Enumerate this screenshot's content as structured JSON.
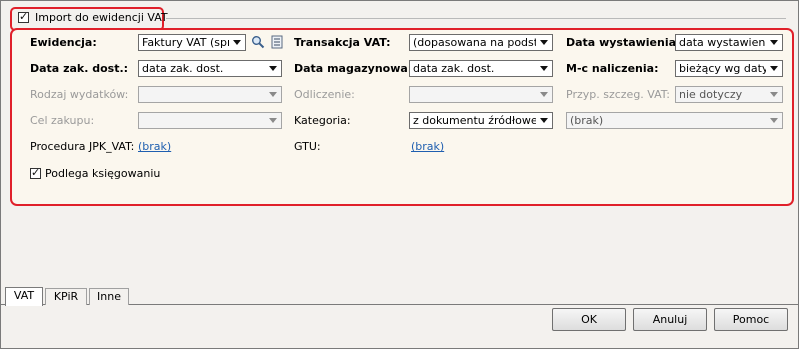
{
  "section": {
    "import_checkbox_label": "Import do ewidencji VAT",
    "import_checked": true
  },
  "fields": {
    "ewidencja": {
      "label": "Ewidencja:",
      "value": "Faktury VAT (sprz"
    },
    "transakcja_vat": {
      "label": "Transakcja VAT:",
      "value": "(dopasowana na podstaw"
    },
    "data_wystawienia": {
      "label": "Data wystawienia:",
      "value": "data wystawienia"
    },
    "data_zak_dost": {
      "label": "Data zak. dost.:",
      "value": "data zak. dost."
    },
    "data_magazynowa": {
      "label": "Data magazynowa:",
      "value": "data zak. dost."
    },
    "mc_naliczenia": {
      "label": "M-c naliczenia:",
      "value": "bieżący wg daty wy"
    },
    "rodzaj_wydatkow": {
      "label": "Rodzaj wydatków:",
      "value": ""
    },
    "odliczenie": {
      "label": "Odliczenie:",
      "value": ""
    },
    "przyp_szczeg_vat": {
      "label": "Przyp. szczeg. VAT:",
      "value": "nie dotyczy"
    },
    "cel_zakupu": {
      "label": "Cel zakupu:",
      "value": ""
    },
    "kategoria": {
      "label": "Kategoria:",
      "value": "z dokumentu źródłowego"
    },
    "kategoria_extra": {
      "value": "(brak)"
    },
    "procedura_jpk": {
      "label": "Procedura JPK_VAT:",
      "value": "(brak)"
    },
    "gtu": {
      "label": "GTU:",
      "value": "(brak)"
    },
    "podlega_ksiegowaniu": {
      "label": "Podlega księgowaniu",
      "checked": true
    }
  },
  "tabs": [
    "VAT",
    "KPiR",
    "Inne"
  ],
  "buttons": {
    "ok": "OK",
    "cancel": "Anuluj",
    "help": "Pomoc"
  },
  "icons": {
    "search": "magnifier-icon",
    "list": "list-icon"
  }
}
